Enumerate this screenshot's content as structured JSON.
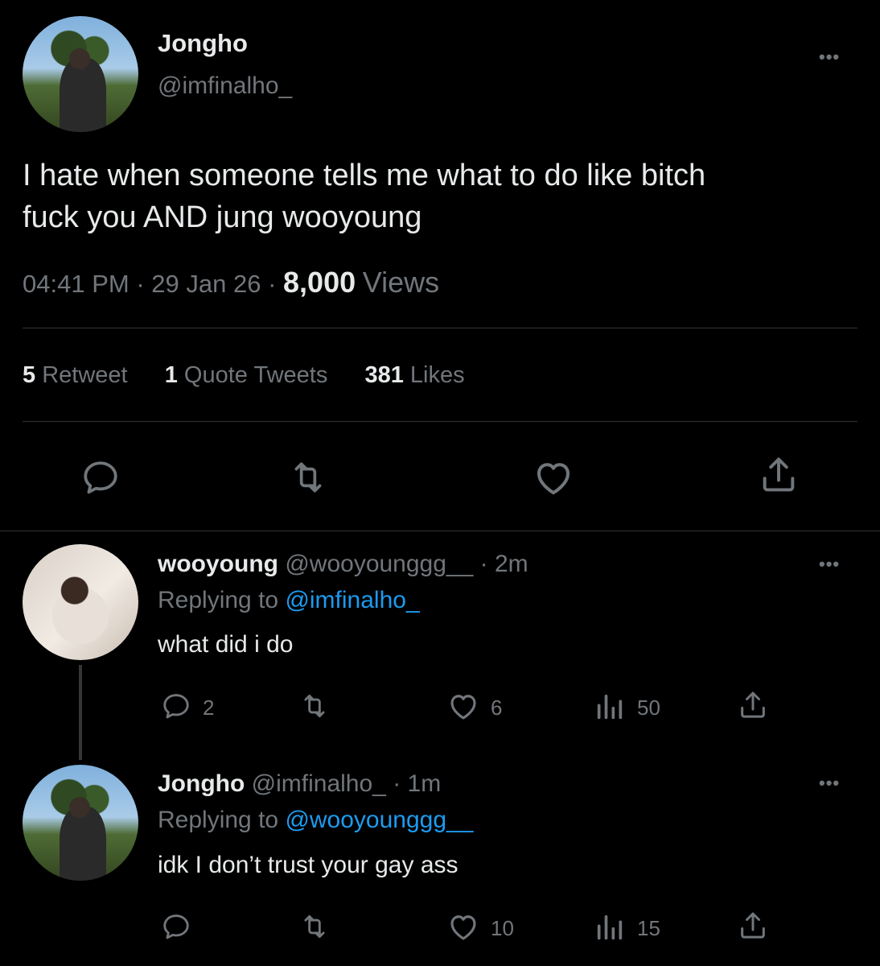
{
  "main_tweet": {
    "display_name": "Jongho",
    "handle": "@imfinalho_",
    "text_line1": "I hate when someone tells me what to do like bitch",
    "text_line2": "fuck you AND jung wooyoung",
    "time": "04:41 PM",
    "sep1": "·",
    "date": "29 Jan 26",
    "sep2": "·",
    "views_count": "8,000",
    "views_label": "Views",
    "retweets_count": "5",
    "retweets_label": "Retweet",
    "quotes_count": "1",
    "quotes_label": "Quote Tweets",
    "likes_count": "381",
    "likes_label": "Likes",
    "more": "•••"
  },
  "replies": [
    {
      "display_name": "wooyoung",
      "handle": "@wooyounggg__",
      "time": "· 2m",
      "replying_prefix": "Replying to",
      "replying_to": "@imfinalho_",
      "text": "what did i do",
      "reply_count": "2",
      "like_count": "6",
      "view_count": "50",
      "more": "•••"
    },
    {
      "display_name": "Jongho",
      "handle": "@imfinalho_",
      "time": "· 1m",
      "replying_prefix": "Replying to",
      "replying_to": "@wooyounggg__",
      "text": "idk I don’t trust your gay ass",
      "reply_count": "",
      "like_count": "10",
      "view_count": "15",
      "more": "•••"
    }
  ],
  "icons": {
    "reply": "reply-icon",
    "retweet": "retweet-icon",
    "like": "heart-icon",
    "views": "views-icon",
    "share": "share-icon"
  },
  "colors": {
    "background": "#000000",
    "text": "#e7e9ea",
    "muted": "#71767b",
    "link": "#1d9bf0",
    "divider": "#2f3336"
  }
}
